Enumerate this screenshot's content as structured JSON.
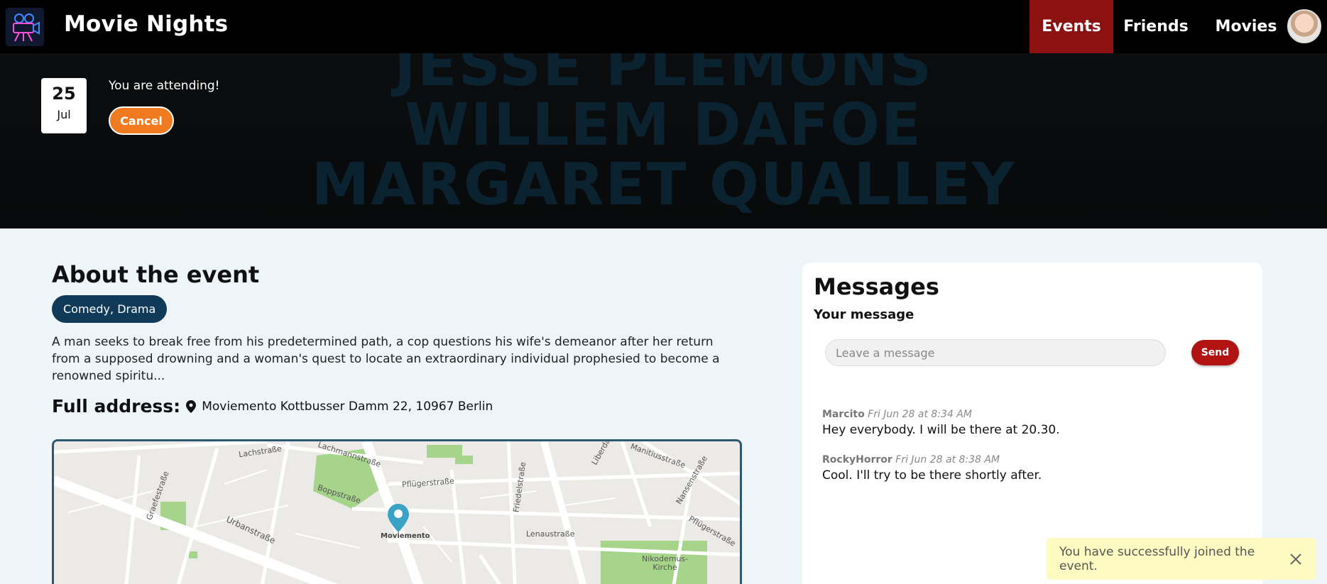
{
  "app": {
    "title": "Movie Nights",
    "logo_icon": "movie-camera-logo"
  },
  "nav": {
    "events": "Events",
    "friends": "Friends",
    "movies": "Movies",
    "active_color": "#8c1111"
  },
  "hero": {
    "background_text": [
      "JESSE PLEMONS",
      "WILLEM DAFOE",
      "MARGARET QUALLEY"
    ],
    "date_day": "25",
    "date_month": "Jul",
    "status": "You are attending!",
    "cancel_label": "Cancel",
    "cancel_color": "#f07a1f"
  },
  "about": {
    "title": "About the event",
    "genres": "Comedy, Drama",
    "description": "A man seeks to break free from his predetermined path, a cop questions his wife's demeanor after her return from a supposed drowning and a woman's quest to locate an extraordinary individual prophesied to become a renowned spiritu...",
    "address_label": "Full address:",
    "address_icon": "map-pin-icon",
    "address_value": "Moviemento  Kottbusser Damm 22, 10967 Berlin"
  },
  "map": {
    "pin_label": "Moviemento",
    "street_labels": {
      "lachstrasse": "Lachstraße",
      "lachmannstrasse": "Lachmannstraße",
      "pflugerstrasse1": "Pflügerstraße",
      "friedelstrasse": "Friedelstraße",
      "liberda": "Liberda",
      "manitiusstrasse": "Manitiusstraße",
      "graefestrasse": "Graefestraße",
      "boppstrasse": "Boppstraße",
      "nansenstrasse": "Nansenstraße",
      "urbanstrasse": "Urbanstraße",
      "lenaustrasse": "Lenaustraße",
      "pflugerstrasse2": "Pflügerstraße",
      "nikodemus": "Nikodemus-\nKirche"
    }
  },
  "messages": {
    "title": "Messages",
    "your_message": "Your message",
    "input_placeholder": "Leave a message",
    "send_label": "Send",
    "send_color": "#b11212",
    "items": [
      {
        "author": "Marcito",
        "time": "Fri Jun 28 at 8:34 AM",
        "text": "Hey everybody. I will be there at 20.30."
      },
      {
        "author": "RockyHorror",
        "time": "Fri Jun 28 at 8:38 AM",
        "text": "Cool. I'll try to be there shortly after."
      }
    ]
  },
  "toast": {
    "text": "You have successfully joined the event.",
    "close_icon": "close-icon",
    "background": "#fdfbc2"
  }
}
